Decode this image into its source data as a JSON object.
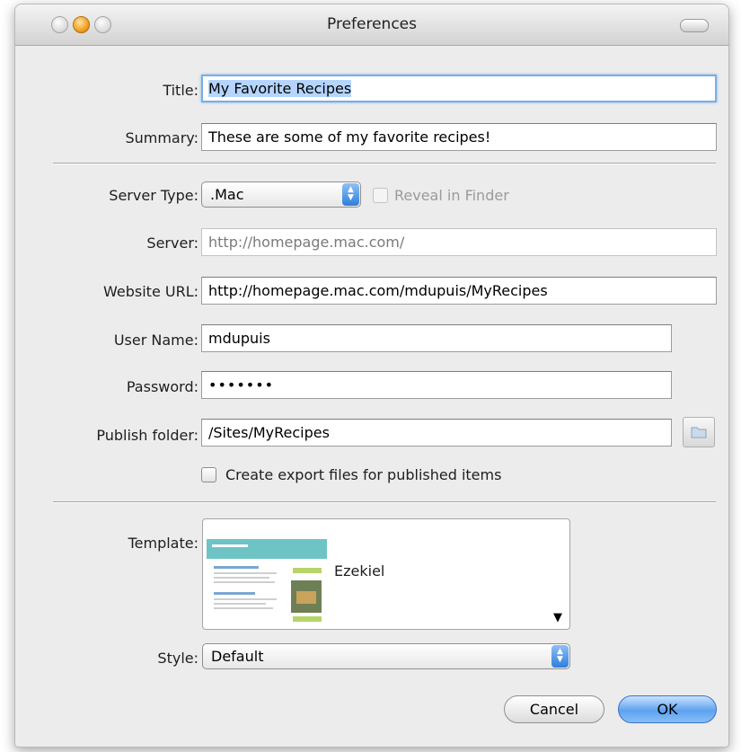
{
  "window": {
    "title": "Preferences"
  },
  "form": {
    "title": {
      "label": "Title:",
      "value": "My Favorite Recipes"
    },
    "summary": {
      "label": "Summary:",
      "value": "These are some of my favorite recipes!"
    },
    "server_type": {
      "label": "Server Type:",
      "value": ".Mac"
    },
    "reveal_in_finder": {
      "label": "Reveal in Finder",
      "checked": false,
      "enabled": false
    },
    "server": {
      "label": "Server:",
      "value": "http://homepage.mac.com/"
    },
    "website_url": {
      "label": "Website URL:",
      "value": "http://homepage.mac.com/mdupuis/MyRecipes"
    },
    "user_name": {
      "label": "User Name:",
      "value": "mdupuis"
    },
    "password": {
      "label": "Password:",
      "value": "•••••••"
    },
    "publish_folder": {
      "label": "Publish folder:",
      "value": "/Sites/MyRecipes"
    },
    "export_files": {
      "label": "Create export files for published items",
      "checked": false
    },
    "template": {
      "label": "Template:",
      "name": "Ezekiel"
    },
    "style": {
      "label": "Style:",
      "value": "Default"
    }
  },
  "buttons": {
    "cancel": "Cancel",
    "ok": "OK"
  },
  "colors": {
    "accent": "#4a90e2",
    "focus_ring": "#79aee6",
    "selection": "#b5d5ff"
  },
  "icons": [
    "close-icon",
    "minimize-icon",
    "zoom-icon",
    "toolbar-toggle-icon",
    "folder-icon",
    "popup-stepper-icon",
    "template-thumbnail",
    "disclosure-arrow-icon"
  ]
}
